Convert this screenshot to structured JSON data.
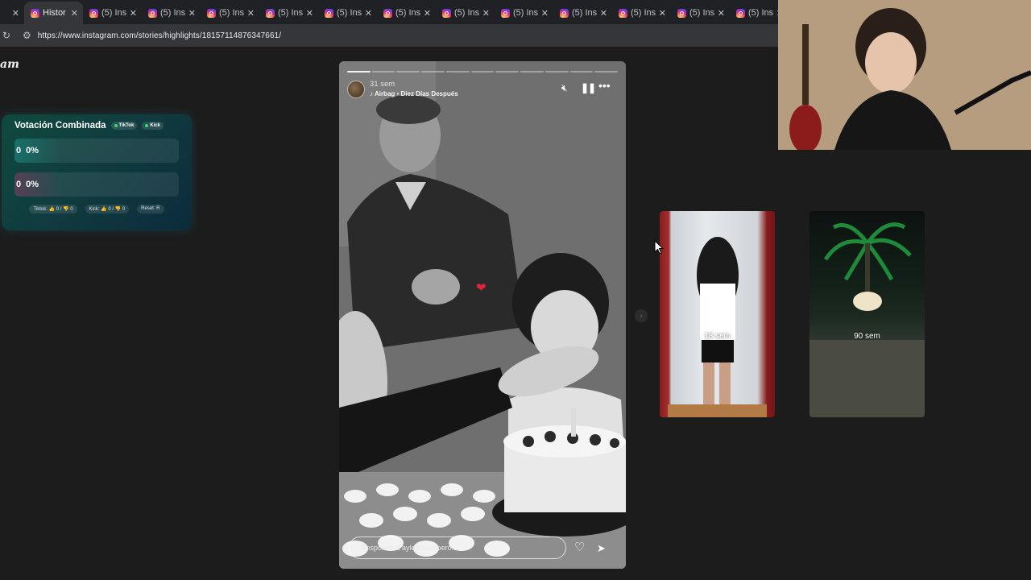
{
  "browser": {
    "tabs": [
      {
        "title": "",
        "active": false
      },
      {
        "title": "Histor",
        "active": true
      },
      {
        "title": "(5) Ins",
        "active": false
      },
      {
        "title": "(5) Ins",
        "active": false
      },
      {
        "title": "(5) Ins",
        "active": false
      },
      {
        "title": "(5) Ins",
        "active": false
      },
      {
        "title": "(5) Ins",
        "active": false
      },
      {
        "title": "(5) Ins",
        "active": false
      },
      {
        "title": "(5) Ins",
        "active": false
      },
      {
        "title": "(5) Ins",
        "active": false
      },
      {
        "title": "(5) Ins",
        "active": false
      },
      {
        "title": "(5) Ins",
        "active": false
      },
      {
        "title": "(5) Ins",
        "active": false
      },
      {
        "title": "(5) Ins",
        "active": false
      }
    ],
    "url": "https://www.instagram.com/stories/highlights/18157114876347661/"
  },
  "page": {
    "logo_fragment": "am"
  },
  "vote": {
    "title": "Votación Combinada",
    "chip_tiktok": "TikTok",
    "chip_kick": "Kick",
    "option1_count": "0",
    "option1_pct": "0%",
    "option2_count": "0",
    "option2_pct": "0%",
    "footer_tiktok": "Tiktok: 👍 0 / 👎 0",
    "footer_kick": "Kick: 👍 0 / 👎 0",
    "footer_reset": "Reset: R"
  },
  "story": {
    "time": "31 sem",
    "music_artist": "Airbag",
    "music_sep": " • ",
    "music_song": "Diez Días Después",
    "reply_placeholder": "Responde a aylenncampero...",
    "progress_total": 11,
    "progress_done": 1
  },
  "thumbs": [
    {
      "label": "18 sem"
    },
    {
      "label": "90 sem"
    }
  ],
  "colors": {
    "story_heart": "#e4243a",
    "vote_bg": "#0f4a3e"
  }
}
